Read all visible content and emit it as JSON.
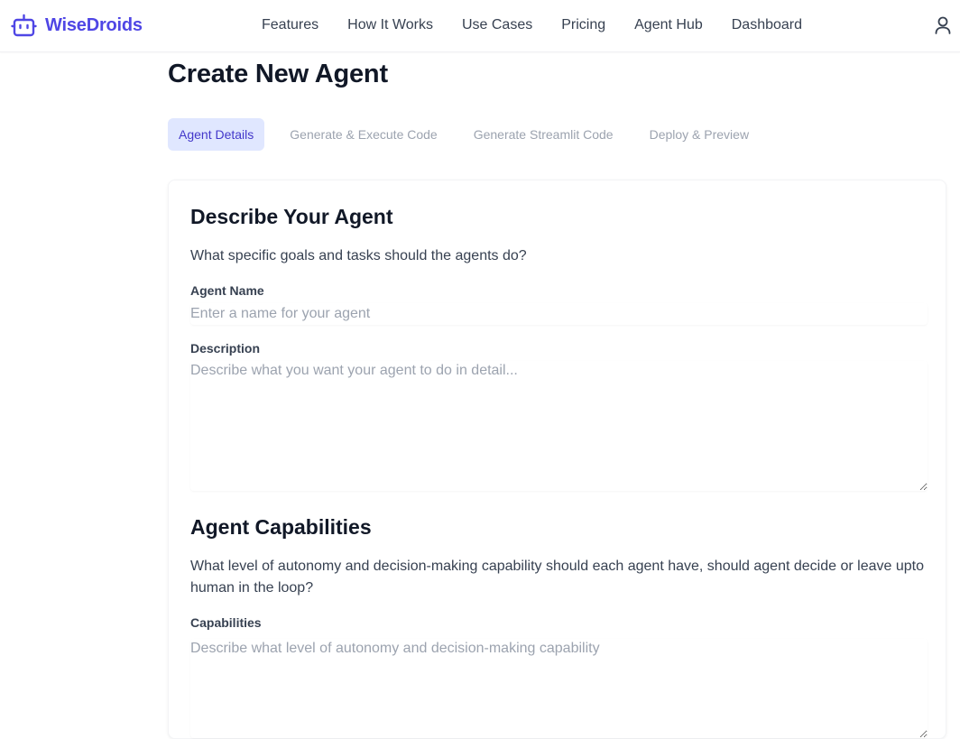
{
  "header": {
    "brand": "WiseDroids",
    "nav": [
      "Features",
      "How It Works",
      "Use Cases",
      "Pricing",
      "Agent Hub",
      "Dashboard"
    ]
  },
  "page": {
    "title": "Create New Agent",
    "tabs": [
      {
        "label": "Agent Details",
        "active": true
      },
      {
        "label": "Generate & Execute Code",
        "active": false
      },
      {
        "label": "Generate Streamlit Code",
        "active": false
      },
      {
        "label": "Deploy & Preview",
        "active": false
      }
    ]
  },
  "describe": {
    "title": "Describe Your Agent",
    "desc": "What specific goals and tasks should the agents do?",
    "name_label": "Agent Name",
    "name_placeholder": "Enter a name for your agent",
    "name_value": "",
    "description_label": "Description",
    "description_placeholder": "Describe what you want your agent to do in detail...",
    "description_value": ""
  },
  "capabilities": {
    "title": "Agent Capabilities",
    "desc": "What level of autonomy and decision-making capability should each agent have, should agent decide or leave upto human in the loop?",
    "label": "Capabilities",
    "placeholder": "Describe what level of autonomy and decision-making capability",
    "value": ""
  },
  "colors": {
    "accent": "#4f46e5",
    "tab_active_bg": "#e0e7ff",
    "tab_active_text": "#4338ca",
    "muted": "#9ca3af"
  },
  "icons": {
    "brand": "robot-icon",
    "user": "user-icon"
  }
}
